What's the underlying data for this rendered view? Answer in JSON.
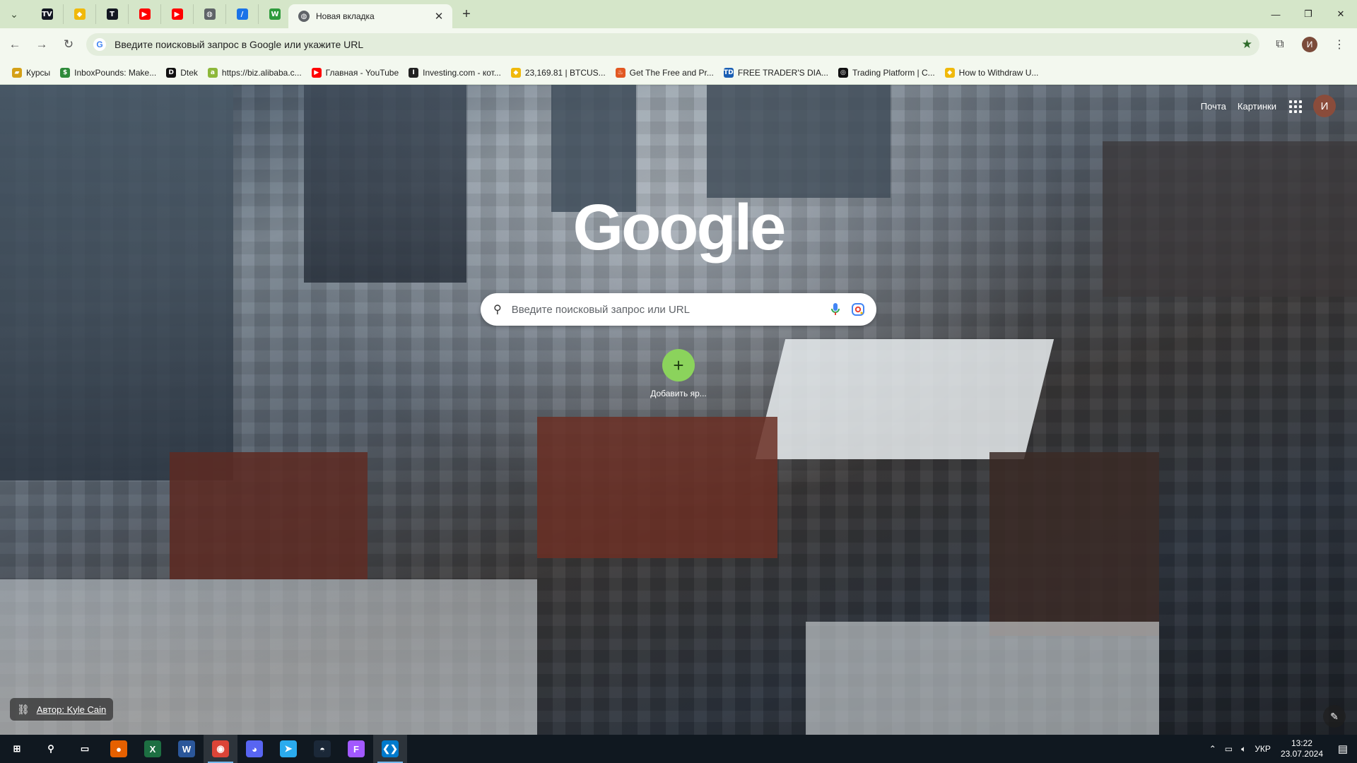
{
  "browser": {
    "active_tab_title": "Новая вкладка",
    "address_text": "Введите поисковый запрос в Google или укажите URL",
    "profile_initial": "И"
  },
  "pinned_tabs": [
    {
      "icon": "tradingview-icon",
      "glyph": "TV",
      "color": "#131722"
    },
    {
      "icon": "binance-icon",
      "glyph": "◆",
      "color": "#f0b90b"
    },
    {
      "icon": "tradingview-icon-2",
      "glyph": "T",
      "color": "#131722"
    },
    {
      "icon": "youtube-icon",
      "glyph": "▶",
      "color": "#ff0000"
    },
    {
      "icon": "youtube-icon-2",
      "glyph": "▶",
      "color": "#ff0000"
    },
    {
      "icon": "globe-icon",
      "glyph": "◍",
      "color": "#5f6368"
    },
    {
      "icon": "feather-icon",
      "glyph": "/",
      "color": "#1a73e8"
    },
    {
      "icon": "w-icon",
      "glyph": "W",
      "color": "#2e9b3c"
    }
  ],
  "bookmarks": [
    {
      "label": "Курсы",
      "icon": "folder-icon",
      "glyph": "▰",
      "color": "#d4a017"
    },
    {
      "label": "InboxPounds: Make...",
      "icon": "inboxpounds-icon",
      "glyph": "$",
      "color": "#2e8b3a"
    },
    {
      "label": "Dtek",
      "icon": "dtek-icon",
      "glyph": "D",
      "color": "#111111"
    },
    {
      "label": "https://biz.alibaba.c...",
      "icon": "alibaba-icon",
      "glyph": "a",
      "color": "#8db83a"
    },
    {
      "label": "Главная - YouTube",
      "icon": "youtube-icon",
      "glyph": "▶",
      "color": "#ff0000"
    },
    {
      "label": "Investing.com - кот...",
      "icon": "investing-icon",
      "glyph": "I",
      "color": "#222222"
    },
    {
      "label": "23,169.81 | BTCUS...",
      "icon": "binance-icon",
      "glyph": "◆",
      "color": "#f0b90b"
    },
    {
      "label": "Get The Free and Pr...",
      "icon": "flame-icon",
      "glyph": "♨",
      "color": "#e25822"
    },
    {
      "label": "FREE TRADER'S DIA...",
      "icon": "td-icon",
      "glyph": "TD",
      "color": "#1a5fb4"
    },
    {
      "label": "Trading Platform | C...",
      "icon": "platform-icon",
      "glyph": "◎",
      "color": "#111111"
    },
    {
      "label": "How to Withdraw U...",
      "icon": "binance-icon",
      "glyph": "◆",
      "color": "#f0b90b"
    }
  ],
  "ntp": {
    "mail_link": "Почта",
    "images_link": "Картинки",
    "logo_text": "Google",
    "search_placeholder": "Введите поисковый запрос или URL",
    "shortcut_label": "Добавить яр...",
    "author_text": "Автор: Kyle Cain",
    "avatar_initial": "И"
  },
  "taskbar": {
    "apps": [
      {
        "icon": "windows-start-icon",
        "glyph": "⊞",
        "color": "transparent",
        "active": false
      },
      {
        "icon": "search-icon",
        "glyph": "⚲",
        "color": "transparent",
        "active": false
      },
      {
        "icon": "task-view-icon",
        "glyph": "▭",
        "color": "transparent",
        "active": false
      },
      {
        "icon": "firefox-icon",
        "glyph": "●",
        "color": "#e66000",
        "active": false
      },
      {
        "icon": "excel-icon",
        "glyph": "X",
        "color": "#1d6f42",
        "active": false
      },
      {
        "icon": "word-icon",
        "glyph": "W",
        "color": "#2b579a",
        "active": false
      },
      {
        "icon": "chrome-icon",
        "glyph": "◉",
        "color": "#db4437",
        "active": true
      },
      {
        "icon": "discord-icon",
        "glyph": "◕",
        "color": "#5865f2",
        "active": false
      },
      {
        "icon": "telegram-icon",
        "glyph": "➤",
        "color": "#2aabee",
        "active": false
      },
      {
        "icon": "steam-icon",
        "glyph": "◓",
        "color": "#1b2838",
        "active": false
      },
      {
        "icon": "figma-icon",
        "glyph": "F",
        "color": "#a259ff",
        "active": false
      },
      {
        "icon": "vscode-icon",
        "glyph": "❮❯",
        "color": "#007acc",
        "active": true
      }
    ],
    "language": "УКР",
    "time": "13:22",
    "date": "23.07.2024"
  }
}
